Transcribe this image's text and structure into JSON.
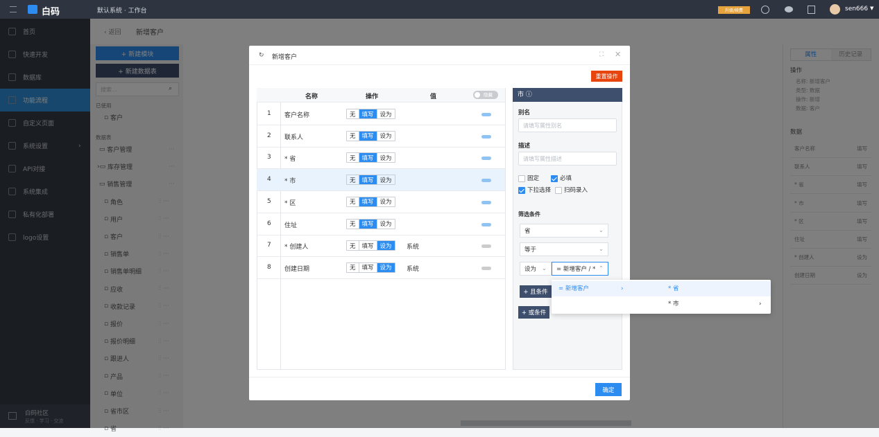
{
  "topbar": {
    "logo": "白码",
    "breadcrumb": "默认系统 · 工作台",
    "upgrade": "升级/续费",
    "user": "sen666"
  },
  "nav": [
    "首页",
    "快速开发",
    "数据库",
    "功能流程",
    "自定义页面",
    "系统设置",
    "API对接",
    "系统集成",
    "私有化部署",
    "logo设置"
  ],
  "community": {
    "title": "白码社区",
    "sub": "反馈 · 学习 · 交流"
  },
  "page": {
    "back": "返回",
    "title": "新增客户"
  },
  "sidebar": {
    "new_module": "+ 新建模块",
    "new_table": "+ 新建数据表",
    "search_ph": "搜索...",
    "used_label": "已使用",
    "used_item": "客户",
    "tables_label": "数据表",
    "items": [
      "客户管理",
      "库存管理",
      "销售管理",
      "角色",
      "用户",
      "客户",
      "销售单",
      "销售单明细",
      "应收",
      "收款记录",
      "报价",
      "报价明细",
      "跟进人",
      "产品",
      "单位",
      "省市区",
      "省"
    ]
  },
  "modal": {
    "title": "新增客户",
    "reset": "重置操作",
    "confirm": "确定",
    "headers": {
      "name": "名称",
      "op": "操作",
      "val": "值",
      "toggle": "隐藏"
    },
    "seg": [
      "无",
      "填写",
      "设为"
    ],
    "rows": [
      {
        "n": "1",
        "name": "客户名称",
        "on": 1,
        "val": ""
      },
      {
        "n": "2",
        "name": "联系人",
        "on": 1,
        "val": ""
      },
      {
        "n": "3",
        "name": "* 省",
        "on": 1,
        "val": ""
      },
      {
        "n": "4",
        "name": "* 市",
        "on": 1,
        "val": ""
      },
      {
        "n": "5",
        "name": "* 区",
        "on": 1,
        "val": ""
      },
      {
        "n": "6",
        "name": "住址",
        "on": 1,
        "val": ""
      },
      {
        "n": "7",
        "name": "* 创建人",
        "on": 2,
        "val": "系统"
      },
      {
        "n": "8",
        "name": "创建日期",
        "on": 2,
        "val": "系统"
      }
    ],
    "panel": {
      "title": "市",
      "alias_label": "别名",
      "alias_ph": "请填写属性别名",
      "desc_label": "描述",
      "desc_ph": "请填写属性描述",
      "fixed": "固定",
      "required": "必填",
      "dropdown": "下拉选择",
      "scan": "扫码录入",
      "filter_label": "筛选条件",
      "f1": "省",
      "f2": "等于",
      "f3a": "设为",
      "f3b": "= 新增客户 / *",
      "and": "+ 且条件",
      "or": "+ 或条件"
    },
    "cascader": {
      "a": "= 新增客户",
      "b1": "* 省",
      "b2": "* 市"
    }
  },
  "right": {
    "tab1": "属性",
    "tab2": "历史记录",
    "op_label": "操作",
    "op_lines": [
      "名称: 新增客户",
      "类型: 数据",
      "操作: 新增",
      "数据: 客户"
    ],
    "data_label": "数据",
    "rows": [
      [
        "客户名称",
        "填写"
      ],
      [
        "联系人",
        "填写"
      ],
      [
        "* 省",
        "填写"
      ],
      [
        "* 市",
        "填写"
      ],
      [
        "* 区",
        "填写"
      ],
      [
        "住址",
        "填写"
      ],
      [
        "* 创建人",
        "设为"
      ],
      [
        "创建日期",
        "设为"
      ]
    ]
  }
}
